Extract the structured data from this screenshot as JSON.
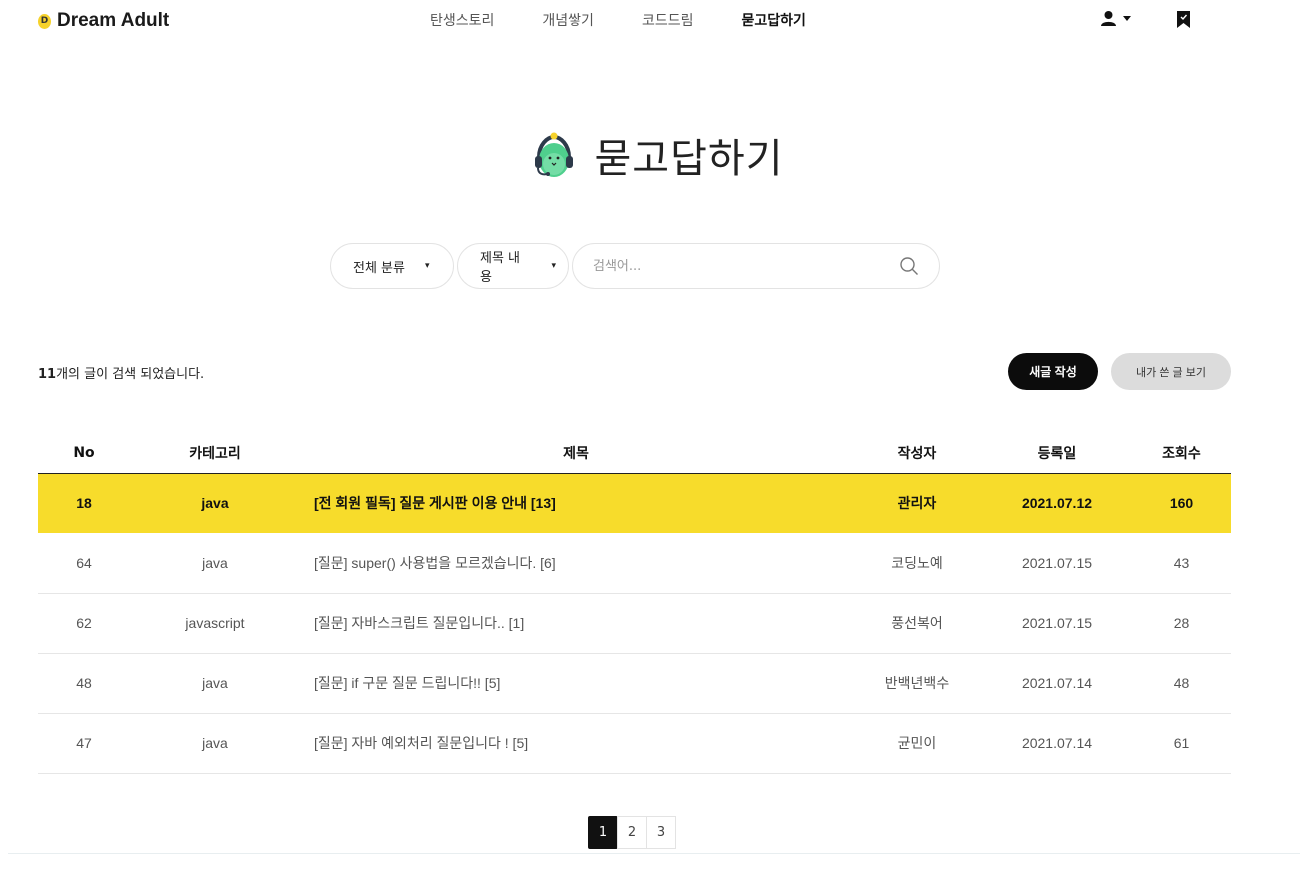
{
  "header": {
    "logo_text": "Dream Adult",
    "nav": [
      {
        "label": "탄생스토리",
        "active": false
      },
      {
        "label": "개념쌓기",
        "active": false
      },
      {
        "label": "코드드림",
        "active": false
      },
      {
        "label": "묻고답하기",
        "active": true
      }
    ],
    "icons": {
      "user": "user-icon",
      "dropdown": "caret-down-icon",
      "bookmark": "bookmark-icon"
    }
  },
  "page": {
    "title": "묻고답하기",
    "mascot_icon": "mascot-headset-icon"
  },
  "search": {
    "category_selected": "전체 분류",
    "field_selected": "제목 내용",
    "placeholder": "검색어...",
    "value": ""
  },
  "result": {
    "count": "11",
    "suffix": "개의 글이 검색 되었습니다."
  },
  "buttons": {
    "write": "새글 작성",
    "mine": "내가 쓴 글 보기"
  },
  "table": {
    "headers": [
      "No",
      "카테고리",
      "제목",
      "작성자",
      "등록일",
      "조회수"
    ],
    "rows": [
      {
        "no": "18",
        "category": "java",
        "title": "[전 회원 필독] 질문 게시판 이용 안내 [13]",
        "author": "관리자",
        "date": "2021.07.12",
        "views": "160",
        "notice": true
      },
      {
        "no": "64",
        "category": "java",
        "title": "[질문] super() 사용법을 모르겠습니다. [6]",
        "author": "코딩노예",
        "date": "2021.07.15",
        "views": "43",
        "notice": false
      },
      {
        "no": "62",
        "category": "javascript",
        "title": "[질문] 자바스크립트 질문입니다.. [1]",
        "author": "풍선복어",
        "date": "2021.07.15",
        "views": "28",
        "notice": false
      },
      {
        "no": "48",
        "category": "java",
        "title": "[질문] if 구문 질문 드립니다!! [5]",
        "author": "반백년백수",
        "date": "2021.07.14",
        "views": "48",
        "notice": false
      },
      {
        "no": "47",
        "category": "java",
        "title": "[질문] 자바 예외처리 질문입니다 ! [5]",
        "author": "균민이",
        "date": "2021.07.14",
        "views": "61",
        "notice": false
      }
    ]
  },
  "pagination": {
    "pages": [
      "1",
      "2",
      "3"
    ],
    "current": "1"
  },
  "colors": {
    "accent_yellow": "#f7dc2b",
    "dark": "#0c0c0c",
    "muted_button": "#dcdcdc"
  }
}
